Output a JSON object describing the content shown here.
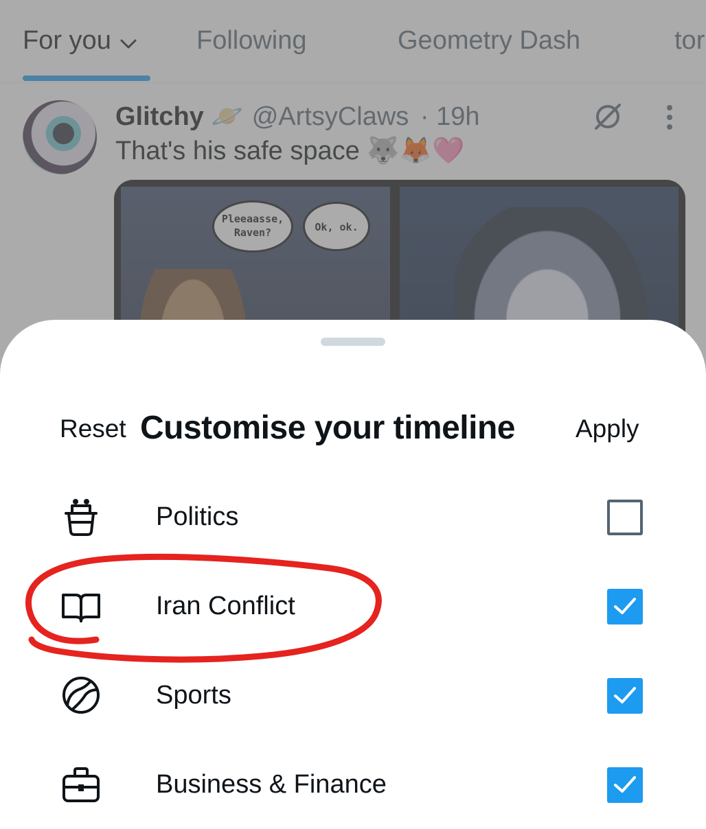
{
  "tabs": [
    {
      "label": "For you",
      "active": true
    },
    {
      "label": "Following",
      "active": false
    },
    {
      "label": "Geometry Dash",
      "active": false
    },
    {
      "label": "tor",
      "active": false
    }
  ],
  "tweet": {
    "name": "Glitchy",
    "name_emoji": "🪐",
    "handle": "@ArtsyClaws",
    "time": "· 19h",
    "text": "That's his safe space 🐺🦊🩷",
    "comic": {
      "bubble_one": "Pleeaasse, Raven?",
      "bubble_two": "Ok, ok."
    }
  },
  "sheet": {
    "reset_label": "Reset",
    "title": "Customise your timeline",
    "apply_label": "Apply",
    "topics": [
      {
        "label": "Politics",
        "icon": "politics-icon",
        "checked": false
      },
      {
        "label": "Iran Conflict",
        "icon": "book-icon",
        "checked": true
      },
      {
        "label": "Sports",
        "icon": "ball-icon",
        "checked": true
      },
      {
        "label": "Business & Finance",
        "icon": "briefcase-icon",
        "checked": true
      }
    ]
  },
  "colors": {
    "accent": "#1d9bf0",
    "annotation": "#e5231f",
    "text_primary": "#0f1419",
    "text_secondary": "#536471"
  }
}
